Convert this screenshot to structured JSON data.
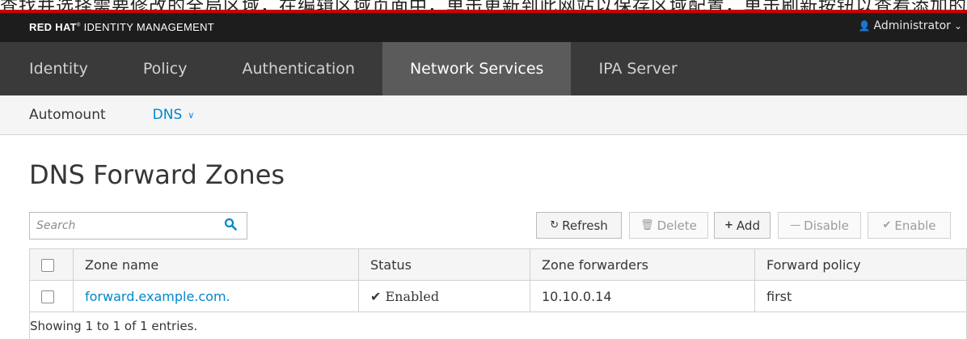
{
  "caption": "查找并选择需要修改的全局区域，在编辑区域页面中，单击更新到此网站以保存区域配置，单击刷新按钮以查看添加的域，这些网站在 Web UI 中将会发布启用。",
  "brand": {
    "bold": "RED HAT",
    "rest": "IDENTITY MANAGEMENT"
  },
  "user": {
    "name": "Administrator"
  },
  "nav": {
    "items": [
      "Identity",
      "Policy",
      "Authentication",
      "Network Services",
      "IPA Server"
    ],
    "active": "Network Services"
  },
  "subnav": {
    "automount": "Automount",
    "dns": "DNS"
  },
  "page": {
    "title": "DNS Forward Zones"
  },
  "search": {
    "placeholder": "Search"
  },
  "toolbar": {
    "refresh": "Refresh",
    "delete": "Delete",
    "add": "Add",
    "disable": "Disable",
    "enable": "Enable"
  },
  "table": {
    "headers": [
      "Zone name",
      "Status",
      "Zone forwarders",
      "Forward policy"
    ],
    "rows": [
      {
        "zone": "forward.example.com.",
        "status": "Enabled",
        "forwarders": "10.10.0.14",
        "policy": "first"
      }
    ]
  },
  "footer": {
    "text": "Showing 1 to 1 of 1 entries."
  },
  "colors": {
    "accent": "#0088ce",
    "brand_red": "#cc0000",
    "masthead": "#1d1d1d",
    "nav": "#3a3a3a",
    "nav_active": "#5b5b5b"
  }
}
